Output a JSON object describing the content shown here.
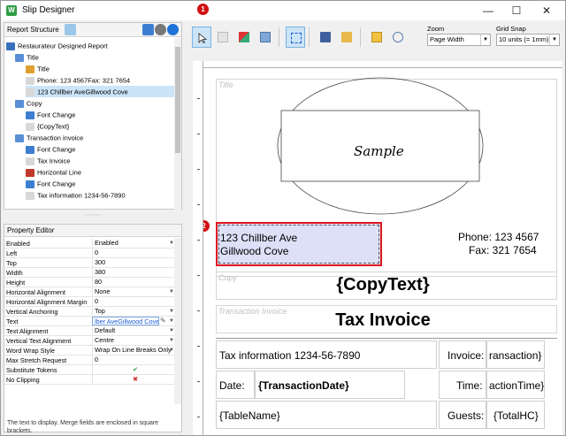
{
  "window": {
    "title": "Slip Designer",
    "minimize": "—",
    "maximize": "☐",
    "close": "✕"
  },
  "markers": {
    "one": "1",
    "two": "2"
  },
  "structure": {
    "header": "Report Structure",
    "items": [
      {
        "label": "Restaurateur Designed Report"
      },
      {
        "label": "Title"
      },
      {
        "label": "Title"
      },
      {
        "label": "Phone: 123 4567Fax: 321 7654"
      },
      {
        "label": "123 Chillber AveGillwood Cove"
      },
      {
        "label": "Copy"
      },
      {
        "label": "Font Change"
      },
      {
        "label": "{CopyText}"
      },
      {
        "label": "Transaction invoice"
      },
      {
        "label": "Font Change"
      },
      {
        "label": "Tax Invoice"
      },
      {
        "label": "Horizontal Line"
      },
      {
        "label": "Font Change"
      },
      {
        "label": "Tax information 1234-56-7890"
      }
    ]
  },
  "properties": {
    "header": "Property Editor",
    "rows": [
      {
        "key": "Enabled",
        "value": "Enabled"
      },
      {
        "key": "Left",
        "value": "0"
      },
      {
        "key": "Top",
        "value": "300"
      },
      {
        "key": "Width",
        "value": "380"
      },
      {
        "key": "Height",
        "value": "80"
      },
      {
        "key": "Horizontal Alignment",
        "value": "None"
      },
      {
        "key": "Horizontal Alignment Margin",
        "value": "0"
      },
      {
        "key": "Vertical Anchoring",
        "value": "Top"
      },
      {
        "key": "Text",
        "value": "lber AveGillwood Cove"
      },
      {
        "key": "Text Alignment",
        "value": "Default"
      },
      {
        "key": "Vertical Text Alignment",
        "value": "Centre"
      },
      {
        "key": "Word Wrap Style",
        "value": "Wrap On Line Breaks Only"
      },
      {
        "key": "Max Stretch Request",
        "value": "0"
      },
      {
        "key": "Substitute Tokens",
        "value": "✔"
      },
      {
        "key": "No Clipping",
        "value": "✖"
      }
    ],
    "help": "The text to display. Merge fields are enclosed in square brackets."
  },
  "toolbar": {
    "zoom_label": "Zoom",
    "zoom_value": "Page Width",
    "grid_label": "Grid Snap",
    "grid_value": "10 units (= 1mm)"
  },
  "canvas": {
    "title_band": "Title",
    "sample": "Sample",
    "address_line1": "123 Chillber Ave",
    "address_line2": "Gillwood Cove",
    "phone": "Phone: 123 4567",
    "fax": "Fax: 321 7654",
    "copy_band": "Copy",
    "copy_text": "{CopyText}",
    "transaction_band": "Transaction Invoice",
    "tax_invoice": "Tax Invoice",
    "tax_info": "Tax information 1234-56-7890",
    "invoice_label": "Invoice:",
    "invoice_value": "ransaction}",
    "date_label": "Date:",
    "date_value": "{TransactionDate}",
    "time_label": "Time:",
    "time_value": "actionTime}",
    "table_name": "{TableName}",
    "guests_label": "Guests:",
    "guests_value": "{TotalHC}"
  },
  "colors": {
    "selection_border": "#e0141c",
    "selection_fill": "#dde0f7",
    "marker": "#d01010"
  }
}
